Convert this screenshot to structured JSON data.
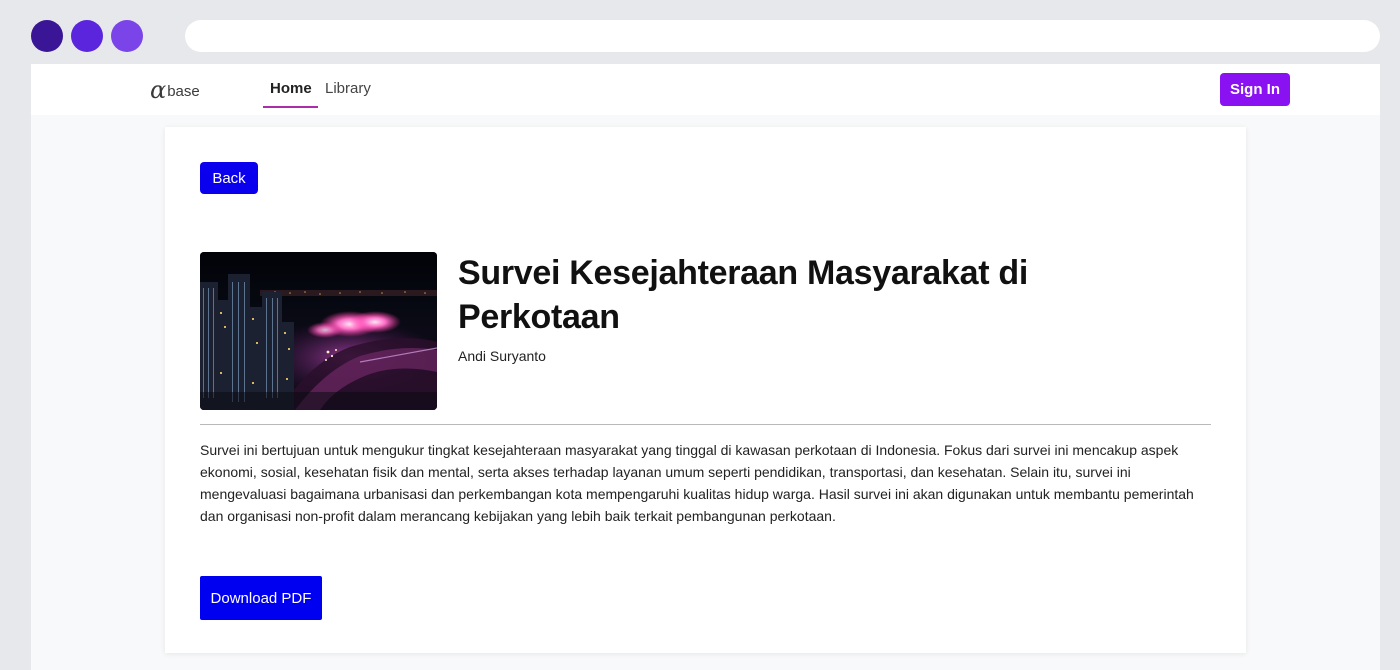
{
  "window": {
    "controls": [
      "close-dot",
      "minimize-dot",
      "maximize-dot"
    ],
    "address": ""
  },
  "nav": {
    "logo_symbol": "α",
    "logo_text": "base",
    "links": [
      {
        "label": "Home",
        "active": true
      },
      {
        "label": "Library",
        "active": false
      }
    ],
    "signin_label": "Sign In",
    "accent_color": "#8a12f2",
    "active_underline_color": "#a92ea8"
  },
  "detail": {
    "back_label": "Back",
    "cover_image_alt": "Night city skyline with fireworks over river",
    "title": "Survei Kesejahteraan Masyarakat di Perkotaan",
    "author": "Andi Suryanto",
    "description": "Survei ini bertujuan untuk mengukur tingkat kesejahteraan masyarakat yang tinggal di kawasan perkotaan di Indonesia. Fokus dari survei ini mencakup aspek ekonomi, sosial, kesehatan fisik dan mental, serta akses terhadap layanan umum seperti pendidikan, transportasi, dan kesehatan. Selain itu, survei ini mengevaluasi bagaimana urbanisasi dan perkembangan kota mempengaruhi kualitas hidup warga. Hasil survei ini akan digunakan untuk membantu pemerintah dan organisasi non-profit dalam merancang kebijakan yang lebih baik terkait pembangunan perkotaan.",
    "download_label": "Download PDF",
    "button_color": "#0a00ee"
  }
}
